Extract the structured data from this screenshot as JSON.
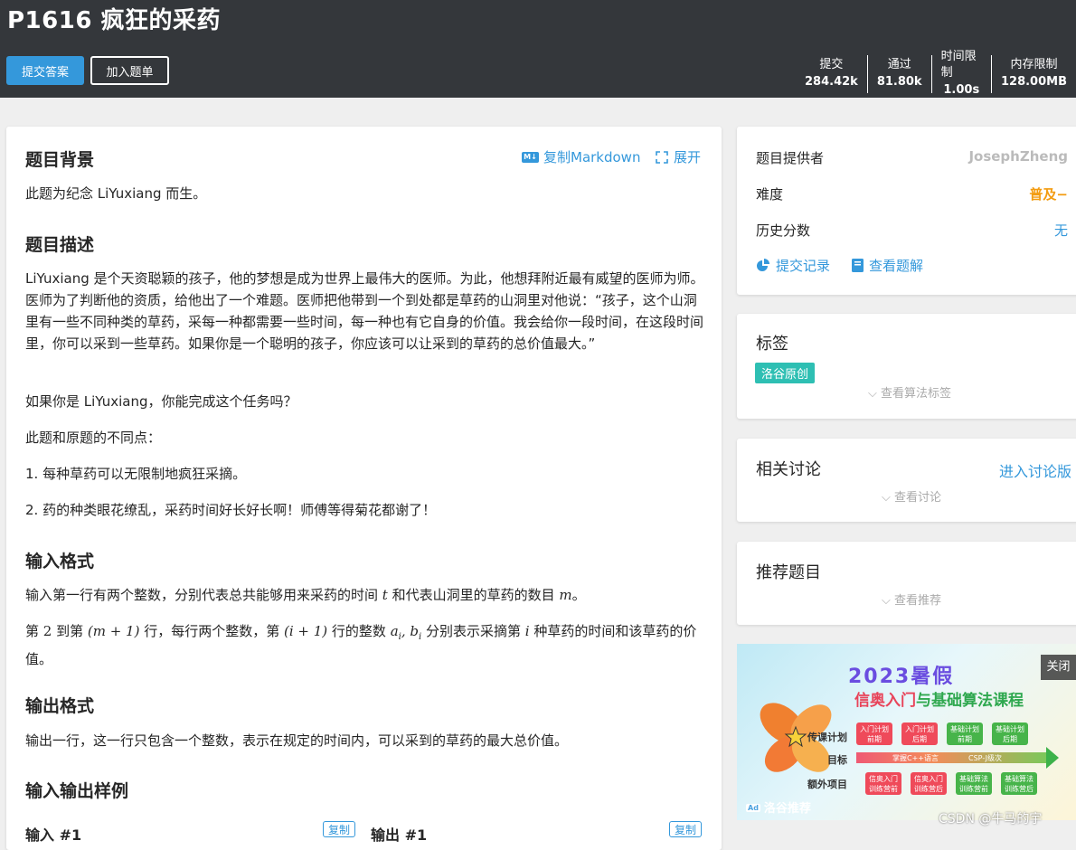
{
  "header": {
    "title": "P1616 疯狂的采药",
    "submit_label": "提交答案",
    "add_label": "加入题单",
    "stats": [
      {
        "label": "提交",
        "value": "284.42k"
      },
      {
        "label": "通过",
        "value": "81.80k"
      },
      {
        "label": "时间限制",
        "value": "1.00s"
      },
      {
        "label": "内存限制",
        "value": "128.00MB"
      }
    ]
  },
  "main": {
    "copy_markdown": "复制Markdown",
    "expand": "展开",
    "background": {
      "heading": "题目背景",
      "text": "此题为纪念 LiYuxiang 而生。"
    },
    "description": {
      "heading": "题目描述",
      "p1": "LiYuxiang 是个天资聪颖的孩子，他的梦想是成为世界上最伟大的医师。为此，他想拜附近最有威望的医师为师。医师为了判断他的资质，给他出了一个难题。医师把他带到一个到处都是草药的山洞里对他说：“孩子，这个山洞里有一些不同种类的草药，采每一种都需要一些时间，每一种也有它自身的价值。我会给你一段时间，在这段时间里，你可以采到一些草药。如果你是一个聪明的孩子，你应该可以让采到的草药的总价值最大。”",
      "p2": "如果你是 LiYuxiang，你能完成这个任务吗？",
      "p3": "此题和原题的不同点：",
      "p4": "1. 每种草药可以无限制地疯狂采摘。",
      "p5": "2. 药的种类眼花缭乱，采药时间好长好长啊！师傅等得菊花都谢了！"
    },
    "input_format": {
      "heading": "输入格式",
      "l1_a": "输入第一行有两个整数，分别代表总共能够用来采药的时间 ",
      "l1_t": "t",
      "l1_b": " 和代表山洞里的草药的数目 ",
      "l1_m": "m",
      "l1_c": "。",
      "l2_a": "第 ",
      "l2_2": "2",
      "l2_b": " 到第 ",
      "l2_m1": "(m + 1)",
      "l2_c": " 行，每行两个整数，第 ",
      "l2_i1": "(i + 1)",
      "l2_d": " 行的整数 ",
      "l2_ab": "a",
      "l2_ab_sub": "i",
      "l2_comma": ", b",
      "l2_b_sub": "i",
      "l2_e": " 分别表示采摘第 ",
      "l2_i": "i",
      "l2_f": " 种草药的时间和该草药的价值。"
    },
    "output_format": {
      "heading": "输出格式",
      "text": "输出一行，这一行只包含一个整数，表示在规定的时间内，可以采到的草药的最大总价值。"
    },
    "samples": {
      "heading": "输入输出样例",
      "input_label": "输入 #1",
      "output_label": "输出 #1",
      "copy": "复制"
    }
  },
  "sidebar": {
    "info": {
      "provider_label": "题目提供者",
      "provider_value": "JosephZheng",
      "difficulty_label": "难度",
      "difficulty_value": "普及−",
      "difficulty_color": "#f39c11",
      "history_label": "历史分数",
      "history_value": "无",
      "records": "提交记录",
      "solutions": "查看题解"
    },
    "tags": {
      "heading": "标签",
      "tag": "洛谷原创",
      "toggle": "查看算法标签"
    },
    "discuss": {
      "heading": "相关讨论",
      "link": "进入讨论版",
      "toggle": "查看讨论"
    },
    "recommend": {
      "heading": "推荐题目",
      "toggle": "查看推荐"
    }
  },
  "ad": {
    "title": "2023暑假",
    "sub_a": "信奥入门",
    "sub_and": "与",
    "sub_b": "基础算法课程",
    "row1_label": "传课计划",
    "row2_label": "目标",
    "row3_label": "额外项目",
    "row1": [
      "入门计划\n前期",
      "入门计划\n后期",
      "基础计划\n前期",
      "基础计划\n后期"
    ],
    "bar_left": "掌握C++语言",
    "bar_right": "CSP-J级次",
    "row3": [
      "信奥入门\n训练营前",
      "信奥入门\n训练营后",
      "基础算法\n训练营前",
      "基础算法\n训练营后"
    ],
    "close": "关闭",
    "badge_icon": "Ad",
    "badge": "洛谷推荐"
  },
  "watermark": "CSDN @牛马的宇"
}
